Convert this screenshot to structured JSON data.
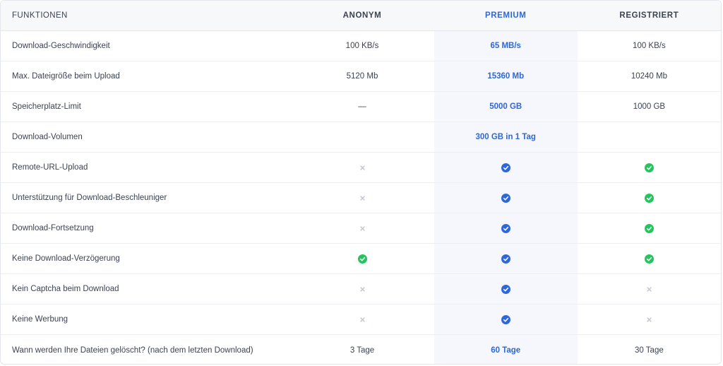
{
  "headers": [
    "FUNKTIONEN",
    "ANONYM",
    "PREMIUM",
    "REGISTRIERT"
  ],
  "colors": {
    "premium": "#2f67d8",
    "check_blue": "#2f67d8",
    "check_green": "#22c55e",
    "cross": "#c3c8d2"
  },
  "rows": [
    {
      "feature": "Download-Geschwindigkeit",
      "anonym": {
        "type": "text",
        "value": "100 KB/s"
      },
      "premium": {
        "type": "text",
        "value": "65 MB/s"
      },
      "registriert": {
        "type": "text",
        "value": "100 KB/s"
      }
    },
    {
      "feature": "Max. Dateigröße beim Upload",
      "anonym": {
        "type": "text",
        "value": "5120 Mb"
      },
      "premium": {
        "type": "text",
        "value": "15360 Mb"
      },
      "registriert": {
        "type": "text",
        "value": "10240 Mb"
      }
    },
    {
      "feature": "Speicherplatz-Limit",
      "anonym": {
        "type": "text",
        "value": "—"
      },
      "premium": {
        "type": "text",
        "value": "5000 GB"
      },
      "registriert": {
        "type": "text",
        "value": "1000 GB"
      }
    },
    {
      "feature": "Download-Volumen",
      "anonym": {
        "type": "empty"
      },
      "premium": {
        "type": "text",
        "value": "300 GB in 1 Tag"
      },
      "registriert": {
        "type": "empty"
      }
    },
    {
      "feature": "Remote-URL-Upload",
      "anonym": {
        "type": "cross"
      },
      "premium": {
        "type": "check-blue"
      },
      "registriert": {
        "type": "check-green"
      }
    },
    {
      "feature": "Unterstützung für Download-Beschleuniger",
      "anonym": {
        "type": "cross"
      },
      "premium": {
        "type": "check-blue"
      },
      "registriert": {
        "type": "check-green"
      }
    },
    {
      "feature": "Download-Fortsetzung",
      "anonym": {
        "type": "cross"
      },
      "premium": {
        "type": "check-blue"
      },
      "registriert": {
        "type": "check-green"
      }
    },
    {
      "feature": "Keine Download-Verzögerung",
      "anonym": {
        "type": "check-green"
      },
      "premium": {
        "type": "check-blue"
      },
      "registriert": {
        "type": "check-green"
      }
    },
    {
      "feature": "Kein Captcha beim Download",
      "anonym": {
        "type": "cross"
      },
      "premium": {
        "type": "check-blue"
      },
      "registriert": {
        "type": "cross"
      }
    },
    {
      "feature": "Keine Werbung",
      "anonym": {
        "type": "cross"
      },
      "premium": {
        "type": "check-blue"
      },
      "registriert": {
        "type": "cross"
      }
    },
    {
      "feature": "Wann werden Ihre Dateien gelöscht? (nach dem letzten Download)",
      "anonym": {
        "type": "text",
        "value": "3 Tage"
      },
      "premium": {
        "type": "text",
        "value": "60 Tage"
      },
      "registriert": {
        "type": "text",
        "value": "30 Tage"
      }
    }
  ]
}
